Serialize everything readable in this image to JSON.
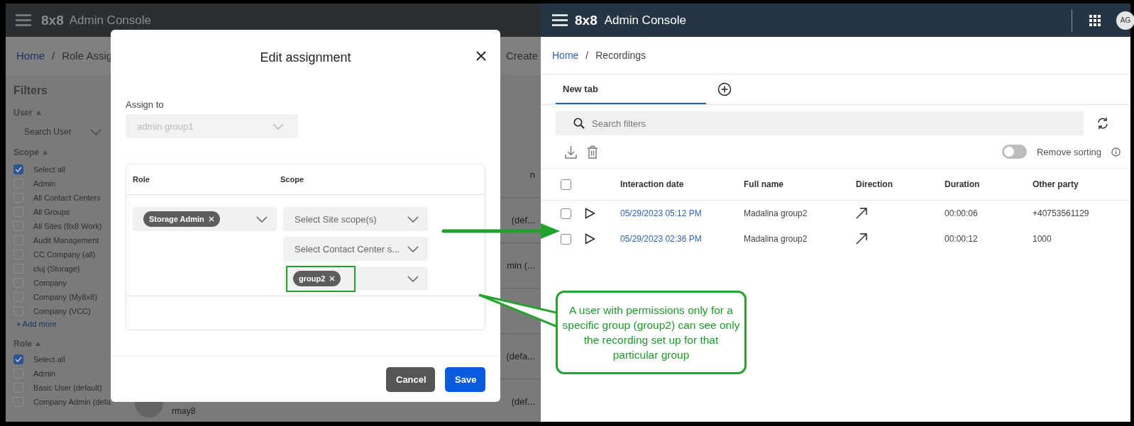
{
  "left_app": {
    "logo": "8x8",
    "title": "Admin Console",
    "breadcrumb": [
      {
        "label": "Home",
        "kind": "link"
      },
      {
        "label": "/",
        "kind": "separator"
      },
      {
        "label": "Role Assig",
        "kind": "current"
      }
    ],
    "create": "Create",
    "filters": {
      "title": "Filters",
      "user": {
        "label": "User",
        "placeholder": "Search User"
      },
      "scope": {
        "label": "Scope",
        "items": [
          {
            "label": "Select all",
            "checked": true
          },
          {
            "label": "Admin",
            "checked": false
          },
          {
            "label": "All Contact Centers",
            "checked": false
          },
          {
            "label": "All Groups",
            "checked": false
          },
          {
            "label": "All Sites (8x8 Work)",
            "checked": false
          },
          {
            "label": "Audit Management",
            "checked": false
          },
          {
            "label": "CC Company (all)",
            "checked": false
          },
          {
            "label": "cluj (Storage)",
            "checked": false
          },
          {
            "label": "Company",
            "checked": false
          },
          {
            "label": "Company (My8x8)",
            "checked": false
          },
          {
            "label": "Company (VCC)",
            "checked": false
          }
        ],
        "add_more": "+ Add more"
      },
      "role": {
        "label": "Role",
        "items": [
          {
            "label": "Select all",
            "checked": true
          },
          {
            "label": "Admin",
            "checked": false
          },
          {
            "label": "Basic User (default)",
            "checked": false
          },
          {
            "label": "Company Admin (defa",
            "checked": false
          }
        ]
      }
    },
    "rows": [
      {
        "cell": "n"
      },
      {
        "cell": "(def..."
      },
      {
        "cell": "min (..."
      },
      {},
      {
        "cell": "(defa..."
      },
      {
        "cell": "(def...",
        "user": "rmay8"
      }
    ]
  },
  "modal": {
    "title": "Edit assignment",
    "assign_to": {
      "label": "Assign to",
      "value": "admin group1",
      "disabled": true
    },
    "columns": [
      "Role",
      "Scope"
    ],
    "role_chip": "Storage Admin",
    "scope_fields": [
      {
        "placeholder": "Select Site scope(s)"
      },
      {
        "placeholder": "Select Contact Center s..."
      },
      {
        "chip": "group2"
      }
    ],
    "buttons": [
      {
        "label": "Cancel",
        "kind": "secondary"
      },
      {
        "label": "Save",
        "kind": "primary"
      }
    ]
  },
  "right_app": {
    "logo": "8x8",
    "title": "Admin Console",
    "avatar": "AG",
    "breadcrumb": [
      {
        "label": "Home",
        "kind": "link"
      },
      {
        "label": "/",
        "kind": "separator"
      },
      {
        "label": "Recordings",
        "kind": "current"
      }
    ],
    "tabs": [
      {
        "label": "New tab",
        "selected": true
      }
    ],
    "search": {
      "placeholder": "Search filters"
    },
    "remove_sorting": {
      "label": "Remove sorting",
      "on": false
    },
    "table": {
      "all_checked": false,
      "columns": [
        "Interaction date",
        "Full name",
        "Direction",
        "Duration",
        "Other party"
      ],
      "rows": [
        {
          "checked": false,
          "date": "05/29/2023 05:12 PM",
          "name": "Madalina group2",
          "duration": "00:00:06",
          "other_party": "+40753561129"
        },
        {
          "checked": false,
          "date": "05/29/2023 02:36 PM",
          "name": "Madalina group2",
          "duration": "00:00:12",
          "other_party": "1000"
        }
      ]
    }
  },
  "callout": {
    "text": "A user with permissions only for a specific group (group2) can see only the recording set up for that particular group"
  }
}
